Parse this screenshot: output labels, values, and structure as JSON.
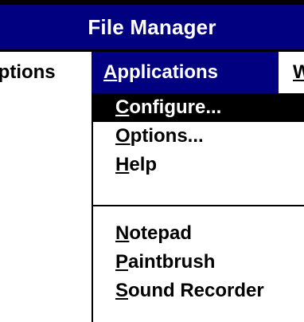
{
  "window": {
    "title": "File Manager"
  },
  "menubar": {
    "options_label": "Options",
    "applications_label": "Applications",
    "applications_mnemonic": "A",
    "applications_rest": "pplications",
    "next_label": "W"
  },
  "dropdown": {
    "items": [
      {
        "mnemonic": "C",
        "rest": "onfigure...",
        "selected": true
      },
      {
        "mnemonic": "O",
        "rest": "ptions...",
        "selected": false
      },
      {
        "mnemonic": "H",
        "rest": "elp",
        "selected": false
      },
      {
        "mnemonic": "N",
        "rest": "otepad",
        "selected": false
      },
      {
        "mnemonic": "P",
        "rest": "aintbrush",
        "selected": false
      },
      {
        "mnemonic": "S",
        "rest": "ound Recorder",
        "selected": false
      }
    ]
  },
  "colors": {
    "title_bar": "#000080",
    "selection": "#000000",
    "menu_highlight": "#000080"
  }
}
